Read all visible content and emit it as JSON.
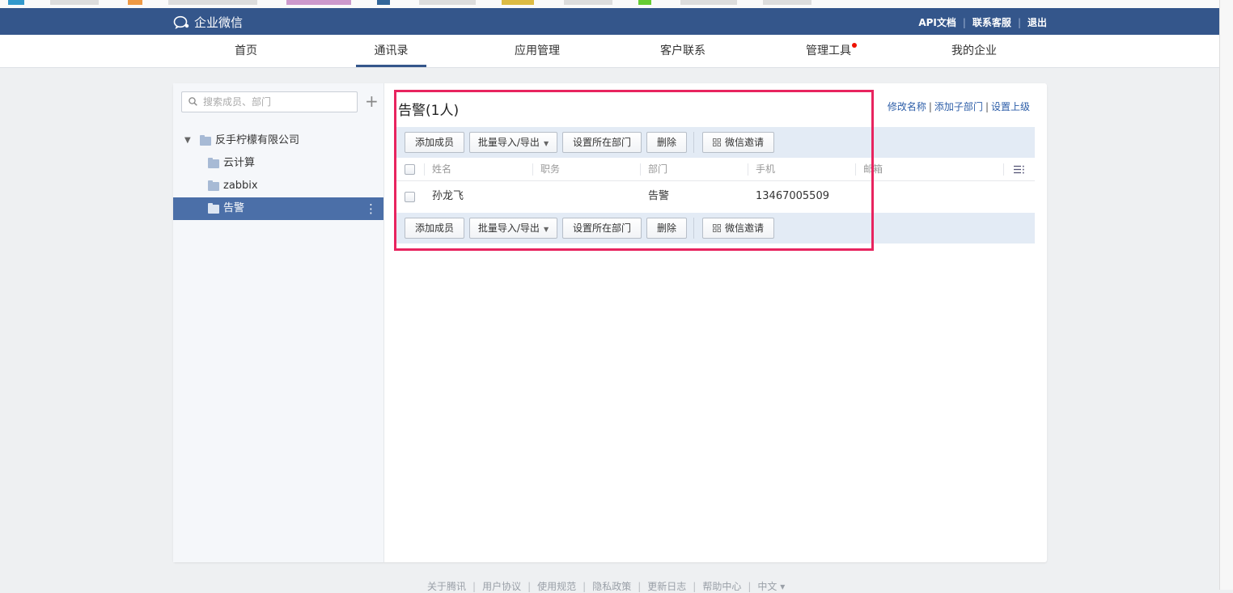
{
  "header": {
    "logo_text": "企业微信",
    "links": [
      "API文档",
      "联系客服",
      "退出"
    ]
  },
  "nav": {
    "items": [
      "首页",
      "通讯录",
      "应用管理",
      "客户联系",
      "管理工具",
      "我的企业"
    ],
    "active_index": 1,
    "badge_item_index": 4
  },
  "sidebar": {
    "search_placeholder": "搜索成员、部门",
    "root": "反手柠檬有限公司",
    "children": [
      "云计算",
      "zabbix",
      "告警"
    ],
    "selected": "告警"
  },
  "main": {
    "title": "告警(1人)",
    "links": [
      "修改名称",
      "添加子部门",
      "设置上级"
    ],
    "toolbar": {
      "add_member": "添加成员",
      "batch_import_export": "批量导入/导出",
      "set_department": "设置所在部门",
      "delete": "删除",
      "wechat_invite": "微信邀请"
    },
    "table": {
      "columns": [
        "姓名",
        "职务",
        "部门",
        "手机",
        "邮箱"
      ],
      "rows": [
        {
          "name": "孙龙飞",
          "position": "",
          "department": "告警",
          "phone": "13467005509",
          "email": ""
        }
      ]
    }
  },
  "footer": {
    "links": [
      "关于腾讯",
      "用户协议",
      "使用规范",
      "隐私政策",
      "更新日志",
      "帮助中心",
      "中文 ▾"
    ]
  },
  "colors": {
    "header_bg": "#34568b",
    "selected_item_bg": "#4b6fa8",
    "toolbar_bg": "#e3ebf5",
    "highlight_border": "#e8245f",
    "badge": "#ee1100"
  }
}
